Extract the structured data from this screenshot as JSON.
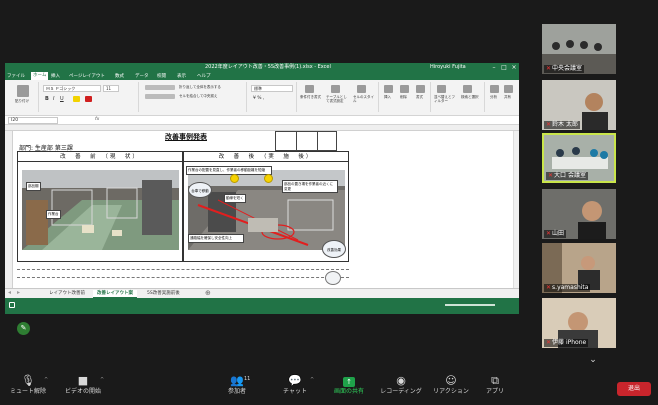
{
  "excel": {
    "title": "2022年度レイアウト改善・5S改善事例(1).xlsx - Excel",
    "user": "Hiroyuki Fujita",
    "menu": [
      "ファイル",
      "ホーム",
      "挿入",
      "ページレイアウト",
      "数式",
      "データ",
      "校閲",
      "表示",
      "ヘルプ"
    ],
    "active_menu": "ホーム",
    "font_name": "ＭＳ Ｐゴシック",
    "font_size": "11",
    "number_format": "標準",
    "cell_ref": "I20",
    "fx": "fx",
    "ribbon_labels": [
      "貼り付け",
      "折り返して全体を表示する",
      "セルを結合して中央揃え",
      "条件付き書式",
      "テーブルとして書式設定",
      "セルのスタイル",
      "挿入",
      "削除",
      "書式",
      "並べ替えとフィルター",
      "検索と選択",
      "分析",
      "共有"
    ]
  },
  "sheet": {
    "title": "改善事例発表",
    "subtitle": "部門: 生産部 第三課",
    "before_label": "改　善　前　（現　状）",
    "after_label": "改　善　後　（実　施　後）",
    "notes": {
      "n1": "部品棚",
      "n2": "作業台",
      "n3": "動線を短く",
      "n4": "台車で移動",
      "n5": "作業台の配置を見直し、作業者の移動距離を短縮",
      "n6": "部品の置き場を作業者の近くに変更",
      "n7": "通路幅を確保し安全性向上",
      "n8": "改善効果"
    }
  },
  "sheet_tabs": [
    "レイアウト改善前",
    "改善レイアウト案",
    "5S改善実施前後"
  ],
  "active_tab": "改善レイアウト案",
  "participants": [
    {
      "name": "中央会議室"
    },
    {
      "name": "鈴木 太郎"
    },
    {
      "name": "大口 会議室"
    },
    {
      "name": "山田"
    },
    {
      "name": "s.yamashita"
    },
    {
      "name": "伊藤 iPhone"
    }
  ],
  "controls": {
    "mute": "ミュート解除",
    "video": "ビデオの開始",
    "participants": "参加者",
    "participants_count": "11",
    "chat": "チャット",
    "share": "画面の共有",
    "record": "レコーディング",
    "reactions": "リアクション",
    "apps": "アプリ",
    "leave": "退出"
  },
  "colors": {
    "excel_green": "#217346",
    "active_tile": "#c9e54a",
    "leave": "#c8252c",
    "share_green": "#1fa24a"
  }
}
